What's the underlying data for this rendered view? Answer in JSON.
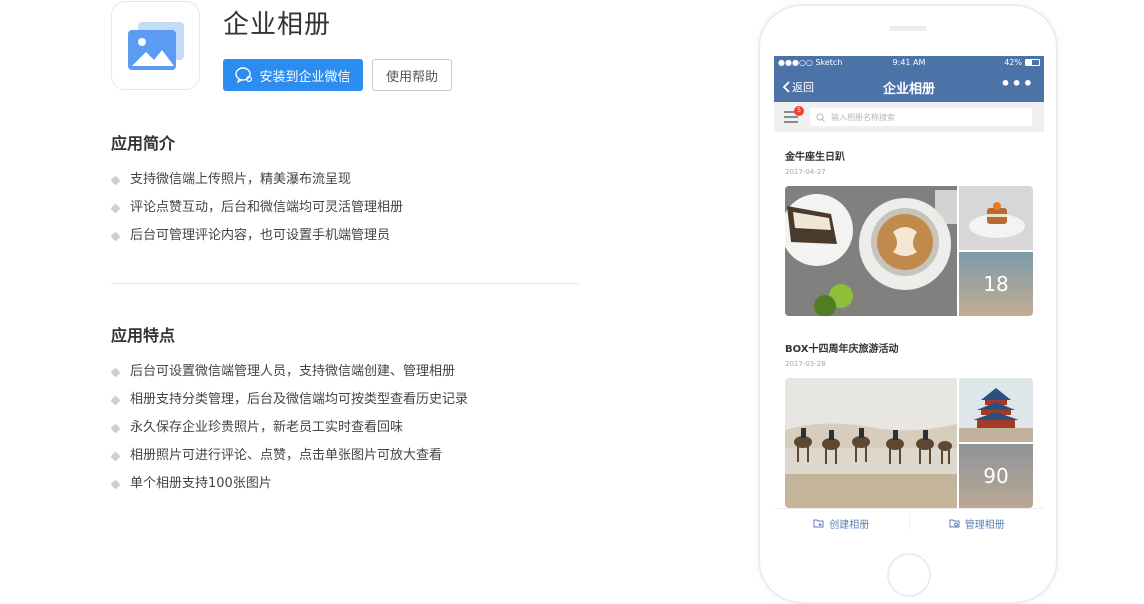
{
  "app": {
    "title": "企业相册",
    "install_button": "安装到企业微信",
    "help_button": "使用帮助"
  },
  "intro": {
    "heading": "应用简介",
    "items": [
      "支持微信端上传照片，精美瀑布流呈现",
      "评论点赞互动，后台和微信端均可灵活管理相册",
      "后台可管理评论内容，也可设置手机端管理员"
    ]
  },
  "features": {
    "heading": "应用特点",
    "items": [
      "后台可设置微信端管理人员，支持微信端创建、管理相册",
      "相册支持分类管理，后台及微信端均可按类型查看历史记录",
      "永久保存企业珍贵照片，新老员工实时查看回味",
      "相册照片可进行评论、点赞，点击单张图片可放大查看",
      "单个相册支持100张图片"
    ]
  },
  "phone": {
    "status": {
      "carrier": "●●●○○ Sketch",
      "time": "9:41 AM",
      "battery": "42%"
    },
    "nav": {
      "back": "返回",
      "title": "企业相册",
      "more": "•••"
    },
    "menu_badge": "5",
    "search_placeholder": "输入相册名称搜索",
    "albums": [
      {
        "title": "金牛座生日趴",
        "date": "2017-04-27",
        "more_count": "18"
      },
      {
        "title": "BOX十四周年庆旅游活动",
        "date": "2017-03-28",
        "more_count": "90"
      }
    ],
    "bottom": {
      "create": "创建相册",
      "manage": "管理相册"
    }
  },
  "colors": {
    "primary": "#2d8cf0",
    "nav": "#4c73a8",
    "badge": "#f04134",
    "link": "#5b82b8"
  }
}
